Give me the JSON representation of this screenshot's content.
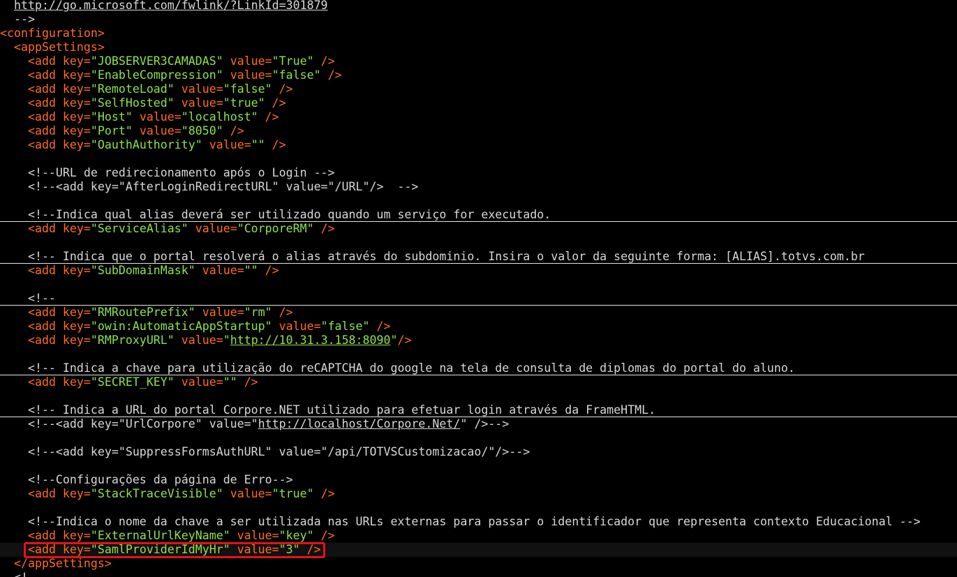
{
  "editor": {
    "language": "xml",
    "theme": {
      "background": "#000000",
      "tag_color": "#ff6c1f",
      "string_color": "#8ee24a",
      "comment_color": "#d8d8d8",
      "highlight_color": "#e8101a"
    },
    "lines": [
      [
        {
          "t": "  "
        },
        {
          "t": "http://go.microsoft.com/fwlink/?LinkId=301879",
          "c": "cmt",
          "u": true
        }
      ],
      [
        {
          "t": "  -->",
          "c": "cmt"
        }
      ],
      [
        {
          "t": "<configuration>",
          "c": "tag"
        }
      ],
      [
        {
          "t": "  "
        },
        {
          "t": "<appSettings>",
          "c": "tag"
        }
      ],
      [
        {
          "t": "    "
        },
        {
          "t": "<add ",
          "c": "tag"
        },
        {
          "t": "key=",
          "c": "attr"
        },
        {
          "t": "\"JOBSERVER3CAMADAS\"",
          "c": "str"
        },
        {
          "t": " value=",
          "c": "attr"
        },
        {
          "t": "\"True\"",
          "c": "str"
        },
        {
          "t": " />",
          "c": "tag"
        }
      ],
      [
        {
          "t": "    "
        },
        {
          "t": "<add ",
          "c": "tag"
        },
        {
          "t": "key=",
          "c": "attr"
        },
        {
          "t": "\"EnableCompression\"",
          "c": "str"
        },
        {
          "t": " value=",
          "c": "attr"
        },
        {
          "t": "\"false\"",
          "c": "str"
        },
        {
          "t": " />",
          "c": "tag"
        }
      ],
      [
        {
          "t": "    "
        },
        {
          "t": "<add ",
          "c": "tag"
        },
        {
          "t": "key=",
          "c": "attr"
        },
        {
          "t": "\"RemoteLoad\"",
          "c": "str"
        },
        {
          "t": " value=",
          "c": "attr"
        },
        {
          "t": "\"false\"",
          "c": "str"
        },
        {
          "t": " />",
          "c": "tag"
        }
      ],
      [
        {
          "t": "    "
        },
        {
          "t": "<add ",
          "c": "tag"
        },
        {
          "t": "key=",
          "c": "attr"
        },
        {
          "t": "\"SelfHosted\"",
          "c": "str"
        },
        {
          "t": " value=",
          "c": "attr"
        },
        {
          "t": "\"true\"",
          "c": "str"
        },
        {
          "t": " />",
          "c": "tag"
        }
      ],
      [
        {
          "t": "    "
        },
        {
          "t": "<add ",
          "c": "tag"
        },
        {
          "t": "key=",
          "c": "attr"
        },
        {
          "t": "\"Host\"",
          "c": "str"
        },
        {
          "t": " value=",
          "c": "attr"
        },
        {
          "t": "\"localhost\"",
          "c": "str"
        },
        {
          "t": " />",
          "c": "tag"
        }
      ],
      [
        {
          "t": "    "
        },
        {
          "t": "<add ",
          "c": "tag"
        },
        {
          "t": "key=",
          "c": "attr"
        },
        {
          "t": "\"Port\"",
          "c": "str"
        },
        {
          "t": " value=",
          "c": "attr"
        },
        {
          "t": "\"8050\"",
          "c": "str"
        },
        {
          "t": " />",
          "c": "tag"
        }
      ],
      [
        {
          "t": "    "
        },
        {
          "t": "<add ",
          "c": "tag"
        },
        {
          "t": "key=",
          "c": "attr"
        },
        {
          "t": "\"OauthAuthority\"",
          "c": "str"
        },
        {
          "t": " value=",
          "c": "attr"
        },
        {
          "t": "\"\"",
          "c": "str"
        },
        {
          "t": " />",
          "c": "tag"
        }
      ],
      [],
      [
        {
          "t": "    <!--URL de redirecionamento após o Login -->",
          "c": "cmt"
        }
      ],
      [
        {
          "t": "    <!--<add key=\"AfterLoginRedirectURL\" value=\"/URL\"/>  -->",
          "c": "cmt"
        }
      ],
      [],
      [
        {
          "t": "    <!--Indica qual alias deverá ser utilizado quando um serviço for executado.",
          "c": "cmt"
        }
      ],
      [
        {
          "t": "    "
        },
        {
          "t": "<add ",
          "c": "tag"
        },
        {
          "t": "key=",
          "c": "attr"
        },
        {
          "t": "\"ServiceAlias\"",
          "c": "str"
        },
        {
          "t": " value=",
          "c": "attr"
        },
        {
          "t": "\"CorporeRM\"",
          "c": "str"
        },
        {
          "t": " />",
          "c": "tag"
        }
      ],
      [],
      [
        {
          "t": "    <!-- Indica que o portal resolverá o alias através do subdominio. Insira o valor da seguinte forma: [ALIAS].totvs.com.br",
          "c": "cmt"
        }
      ],
      [
        {
          "t": "    "
        },
        {
          "t": "<add ",
          "c": "tag"
        },
        {
          "t": "key=",
          "c": "attr"
        },
        {
          "t": "\"SubDomainMask\"",
          "c": "str"
        },
        {
          "t": " value=",
          "c": "attr"
        },
        {
          "t": "\"\"",
          "c": "str"
        },
        {
          "t": " />",
          "c": "tag"
        }
      ],
      [],
      [
        {
          "t": "    <!--",
          "c": "cmt"
        }
      ],
      [
        {
          "t": "    "
        },
        {
          "t": "<add ",
          "c": "tag"
        },
        {
          "t": "key=",
          "c": "attr"
        },
        {
          "t": "\"RMRoutePrefix\"",
          "c": "str"
        },
        {
          "t": " value=",
          "c": "attr"
        },
        {
          "t": "\"rm\"",
          "c": "str"
        },
        {
          "t": " />",
          "c": "tag"
        }
      ],
      [
        {
          "t": "    "
        },
        {
          "t": "<add ",
          "c": "tag"
        },
        {
          "t": "key=",
          "c": "attr"
        },
        {
          "t": "\"owin:AutomaticAppStartup\"",
          "c": "str"
        },
        {
          "t": " value=",
          "c": "attr"
        },
        {
          "t": "\"false\"",
          "c": "str"
        },
        {
          "t": " />",
          "c": "tag"
        }
      ],
      [
        {
          "t": "    "
        },
        {
          "t": "<add ",
          "c": "tag"
        },
        {
          "t": "key=",
          "c": "attr"
        },
        {
          "t": "\"RMProxyURL\"",
          "c": "str"
        },
        {
          "t": " value=",
          "c": "attr"
        },
        {
          "t": "\"",
          "c": "str"
        },
        {
          "t": "http://10.31.3.158:8090",
          "c": "str",
          "u": true
        },
        {
          "t": "\"",
          "c": "str"
        },
        {
          "t": "/>",
          "c": "tag"
        }
      ],
      [],
      [
        {
          "t": "    <!-- Indica a chave para utilização do reCAPTCHA do google na tela de consulta de diplomas do portal do aluno.",
          "c": "cmt"
        }
      ],
      [
        {
          "t": "    "
        },
        {
          "t": "<add ",
          "c": "tag"
        },
        {
          "t": "key=",
          "c": "attr"
        },
        {
          "t": "\"SECRET_KEY\"",
          "c": "str"
        },
        {
          "t": " value=",
          "c": "attr"
        },
        {
          "t": "\"\"",
          "c": "str"
        },
        {
          "t": " />",
          "c": "tag"
        }
      ],
      [],
      [
        {
          "t": "    <!-- Indica a URL do portal Corpore.NET utilizado para efetuar login através da FrameHTML.",
          "c": "cmt"
        }
      ],
      [
        {
          "t": "    <!--<add key=\"UrlCorpore\" value=\"",
          "c": "cmt"
        },
        {
          "t": "http://localhost/Corpore.Net/",
          "c": "cmt",
          "u": true
        },
        {
          "t": "\" />-->",
          "c": "cmt"
        }
      ],
      [],
      [
        {
          "t": "    <!--<add key=\"SuppressFormsAuthURL\" value=\"/api/TOTVSCustomizacao/\"/>-->",
          "c": "cmt"
        }
      ],
      [],
      [
        {
          "t": "    <!--Configurações da página de Erro-->",
          "c": "cmt"
        }
      ],
      [
        {
          "t": "    "
        },
        {
          "t": "<add ",
          "c": "tag"
        },
        {
          "t": "key=",
          "c": "attr"
        },
        {
          "t": "\"StackTraceVisible\"",
          "c": "str"
        },
        {
          "t": " value=",
          "c": "attr"
        },
        {
          "t": "\"true\"",
          "c": "str"
        },
        {
          "t": " />",
          "c": "tag"
        }
      ],
      [],
      [
        {
          "t": "    <!--Indica o nome da chave a ser utilizada nas URLs externas para passar o identificador que representa contexto Educacional -->",
          "c": "cmt"
        }
      ],
      [
        {
          "t": "    "
        },
        {
          "t": "<add ",
          "c": "tag"
        },
        {
          "t": "key=",
          "c": "attr"
        },
        {
          "t": "\"ExternalUrlKeyName\"",
          "c": "str"
        },
        {
          "t": " value=",
          "c": "attr"
        },
        {
          "t": "\"key\"",
          "c": "str"
        },
        {
          "t": " />",
          "c": "tag"
        }
      ],
      [
        {
          "t": "    "
        },
        {
          "t": "<add ",
          "c": "tag"
        },
        {
          "t": "key=",
          "c": "attr"
        },
        {
          "t": "\"SamlProviderIdMyHr\"",
          "c": "str"
        },
        {
          "t": " value=",
          "c": "attr"
        },
        {
          "t": "\"3\"",
          "c": "str"
        },
        {
          "t": " />",
          "c": "tag"
        }
      ],
      [
        {
          "t": "  "
        },
        {
          "t": "</appSettings>",
          "c": "tag"
        }
      ],
      [
        {
          "t": "  <!--",
          "c": "cmt"
        }
      ]
    ],
    "separator_after_lines": [
      15,
      18,
      21,
      26,
      29
    ],
    "highlighted_line": 39
  }
}
